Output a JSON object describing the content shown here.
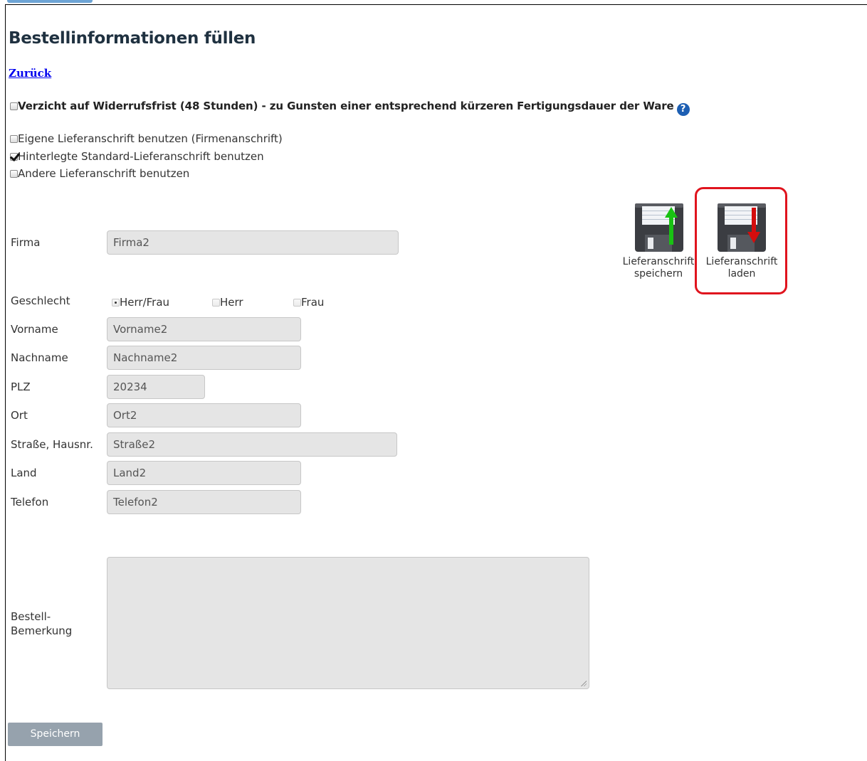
{
  "page": {
    "title": "Bestellinformationen füllen",
    "back_link": "Zurück"
  },
  "waiver": {
    "checked": false,
    "label": "Verzicht auf Widerrufsfrist (48 Stunden) - zu Gunsten einer entsprechend kürzeren Fertigungsdauer der Ware",
    "help_glyph": "?"
  },
  "address_options": [
    {
      "label": "Eigene Lieferanschrift benutzen (Firmenanschrift)",
      "checked": false
    },
    {
      "label": "Hinterlegte Standard-Lieferanschrift benutzen",
      "checked": true
    },
    {
      "label": "Andere Lieferanschrift benutzen",
      "checked": false
    }
  ],
  "form": {
    "firma": {
      "label": "Firma",
      "value": "Firma2"
    },
    "geschlecht": {
      "label": "Geschlecht",
      "options": [
        {
          "label": "Herr/Frau",
          "selected": true
        },
        {
          "label": "Herr",
          "selected": false
        },
        {
          "label": "Frau",
          "selected": false
        }
      ]
    },
    "vorname": {
      "label": "Vorname",
      "value": "Vorname2"
    },
    "nachname": {
      "label": "Nachname",
      "value": "Nachname2"
    },
    "plz": {
      "label": "PLZ",
      "value": "20234"
    },
    "ort": {
      "label": "Ort",
      "value": "Ort2"
    },
    "strasse": {
      "label": "Straße, Hausnr.",
      "value": "Straße2"
    },
    "land": {
      "label": "Land",
      "value": "Land2"
    },
    "telefon": {
      "label": "Telefon",
      "value": "Telefon2"
    },
    "bemerkung": {
      "label_line1": "Bestell-",
      "label_line2": "Bemerkung",
      "value": ""
    }
  },
  "actions": {
    "save_address": {
      "line1": "Lieferanschrift",
      "line2": "speichern",
      "icon": "floppy-save-icon",
      "arrow_color": "#19c213"
    },
    "load_address": {
      "line1": "Lieferanschrift",
      "line2": "laden",
      "icon": "floppy-load-icon",
      "arrow_color": "#d40d0d",
      "highlight_color": "#e0141e"
    },
    "submit_label": "Speichern"
  },
  "colors": {
    "title": "#1f3140",
    "link": "#0000ee",
    "field_bg": "#e5e5e5",
    "button_bg": "#96a2ad",
    "help_icon": "#1d5fb3"
  }
}
